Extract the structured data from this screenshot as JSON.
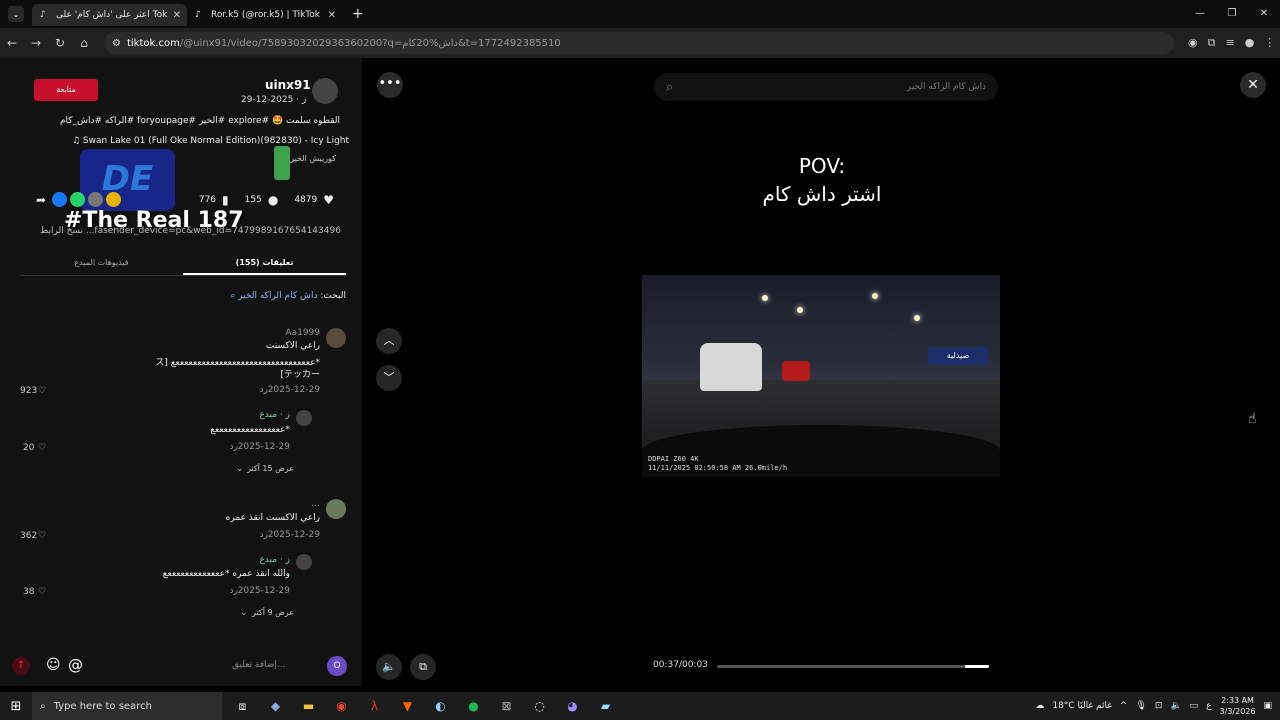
{
  "browser": {
    "tabs": [
      {
        "label": "اعثر على 'داش كام' على Tok"
      },
      {
        "label": "Ror.k5 (@ror.k5) | TikTok"
      }
    ],
    "url_domain": "tiktok.com",
    "url_path": "/@uinx91/video/7589303202936360200?q=داش%20كام&t=1772492385510"
  },
  "post": {
    "follow_label": "متابعة",
    "username": "uinx91",
    "date": "ز · 2025-12-29",
    "description": "القطوه سلمت 🤩 #explore #الخير #foryoupage #الراكه #داش_كام",
    "music": "♫ Swan Lake 01 (Full Oke Normal Edition)(982830) - Icy Light",
    "effect": "كوريبش الخير",
    "overlay_text": "#The Real 187",
    "likes": "4879",
    "comments_count": "155",
    "saves": "776",
    "link": "نسخ الرابط  ...fasender_device=pc&web_id=7479989167654143496",
    "tab_comments": "(155) تعليقات",
    "tab_creator_videos": "فيديوهات المبدع",
    "search_prefix": "البحث: ",
    "search_query": "داش كام الراكه الخير"
  },
  "comments": [
    {
      "user": "Aa1999",
      "text": "راعي الاكسنت",
      "text2": "*ععععععععععععععععععععععععععععععععع [ス",
      "text3": "テッカー]",
      "date": "2025-12-29",
      "reply": "رد",
      "likes": "923"
    },
    {
      "user": "ز · مبدع",
      "text": "*ععععععععععععععععع",
      "date": "2025-12-29",
      "reply": "رد",
      "likes": "20"
    },
    {
      "more": "عرض 15 أكثر"
    },
    {
      "user": "...",
      "text": "راعي الاكسنت انقذ عمره",
      "date": "2025-12-29",
      "reply": "رد",
      "likes": "362"
    },
    {
      "user": "ز · مبدع",
      "text": "والله انقذ عمره *عععععععععععععع",
      "date": "2025-12-29",
      "reply": "رد",
      "likes": "38"
    },
    {
      "more": "عرض 9 أكثر"
    }
  ],
  "composer": {
    "placeholder": "إضافة تعليق...",
    "avatar_letter": "O"
  },
  "player": {
    "search_placeholder": "داش كام الراكه الخير",
    "pov_line1": "POV:",
    "pov_line2": "اشتر داش كام",
    "dashcam_brand": "DDPAI Z60 4K",
    "dashcam_stamp": "11/11/2025 02:50:58 AM  26.0mile/h",
    "sign_text": "صيدلية",
    "time": "00:37/00:03",
    "progress": 0.09
  },
  "taskbar": {
    "search_placeholder": "Type here to search",
    "weather": "18°C  غائم غالبًا",
    "lang": "ع",
    "time": "2:33 AM",
    "date": "3/3/2026"
  }
}
